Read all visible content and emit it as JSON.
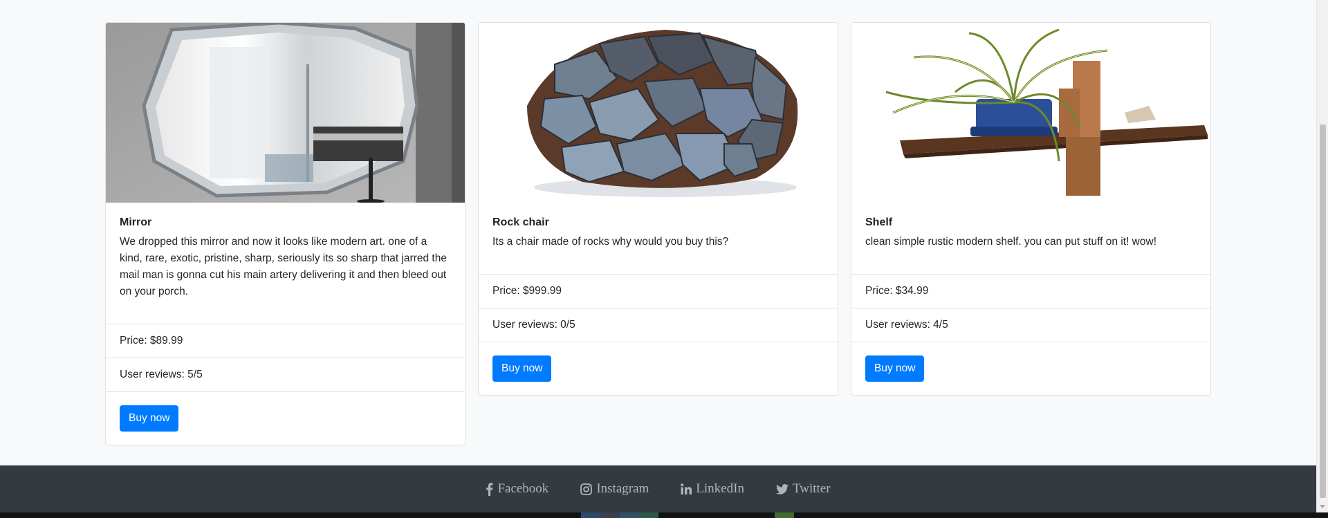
{
  "products": [
    {
      "title": "Mirror",
      "description": "We dropped this mirror and now it looks like modern art. one of a kind, rare, exotic, pristine, sharp, seriously its so sharp that jarred the mail man is gonna cut his main artery delivering it and then bleed out on your porch.",
      "price": "Price: $89.99",
      "reviews": "User reviews: 5/5",
      "button_label": "Buy now"
    },
    {
      "title": "Rock chair",
      "description": "Its a chair made of rocks why would you buy this?",
      "price": "Price: $999.99",
      "reviews": "User reviews: 0/5",
      "button_label": "Buy now"
    },
    {
      "title": "Shelf",
      "description": "clean simple rustic modern shelf. you can put stuff on it! wow!",
      "price": "Price: $34.99",
      "reviews": "User reviews: 4/5",
      "button_label": "Buy now"
    }
  ],
  "footer": {
    "links": [
      {
        "label": "Facebook",
        "icon": "facebook-icon"
      },
      {
        "label": "Instagram",
        "icon": "instagram-icon"
      },
      {
        "label": "LinkedIn",
        "icon": "linkedin-icon"
      },
      {
        "label": "Twitter",
        "icon": "twitter-icon"
      }
    ]
  },
  "colors": {
    "page_background": "#f8f9fa",
    "button_primary": "#007bff",
    "footer_background": "#343a40",
    "footer_text": "#adb5bd"
  }
}
